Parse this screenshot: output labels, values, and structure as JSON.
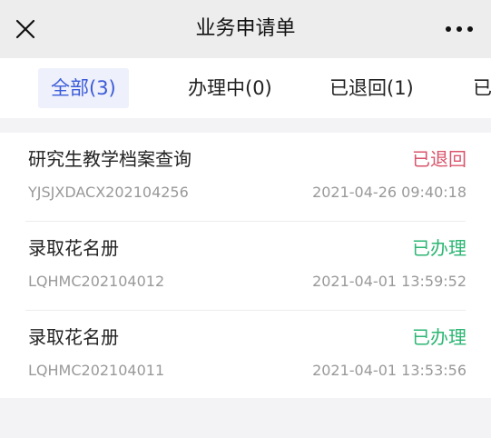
{
  "header": {
    "close_icon": "close-icon",
    "title": "业务申请单",
    "more_icon": "more-dots-icon"
  },
  "tabs": [
    {
      "label": "全部(3)",
      "active": true
    },
    {
      "label": "办理中(0)",
      "active": false
    },
    {
      "label": "已退回(1)",
      "active": false
    },
    {
      "label": "已",
      "active": false
    }
  ],
  "items": [
    {
      "name": "研究生教学档案查询",
      "status": "已退回",
      "code": "YJSJXDACX202104256",
      "time": "2021-04-26 09:40:18"
    },
    {
      "name": "录取花名册",
      "status": "已办理",
      "code": "LQHMC202104012",
      "time": "2021-04-01 13:59:52"
    },
    {
      "name": "录取花名册",
      "status": "已办理",
      "code": "LQHMC202104011",
      "time": "2021-04-01 13:53:56"
    }
  ],
  "colors": {
    "accent": "#3a5bd9",
    "status_returned": "#d9546b",
    "status_done": "#2bb673"
  }
}
